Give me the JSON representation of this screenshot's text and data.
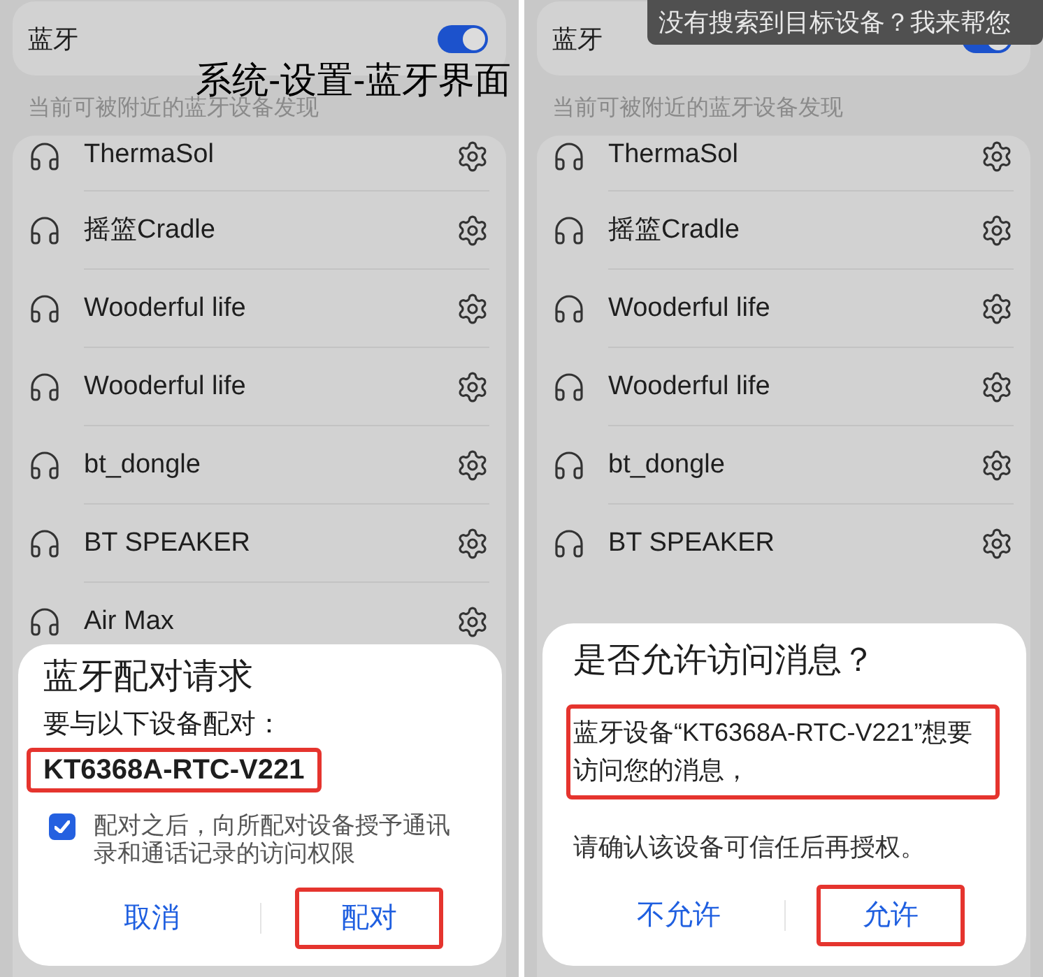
{
  "annotation": {
    "caption": "系统-设置-蓝牙界面"
  },
  "panels": [
    {
      "bluetooth": {
        "label": "蓝牙",
        "on": true
      },
      "visibility_hint": "当前可被附近的蓝牙设备发现",
      "devices": [
        {
          "name": "ThermaSol"
        },
        {
          "name": "摇篮Cradle"
        },
        {
          "name": "Wooderful life"
        },
        {
          "name": "Wooderful life"
        },
        {
          "name": "bt_dongle"
        },
        {
          "name": "BT SPEAKER"
        },
        {
          "name": "Air Max"
        }
      ],
      "dialog": {
        "kind": "pairing",
        "title": "蓝牙配对请求",
        "prompt": "要与以下设备配对：",
        "device": {
          "name": "KT6368A-RTC-V221",
          "highlighted": true
        },
        "consent": {
          "text": "配对之后，向所配对设备授予通讯录和通话记录的访问权限",
          "checked": true
        },
        "buttons": [
          {
            "label": "取消",
            "highlighted": false
          },
          {
            "label": "配对",
            "highlighted": true
          }
        ]
      }
    },
    {
      "toast": "没有搜索到目标设备？我来帮您",
      "bluetooth": {
        "label": "蓝牙",
        "on": true
      },
      "visibility_hint": "当前可被附近的蓝牙设备发现",
      "devices": [
        {
          "name": "ThermaSol"
        },
        {
          "name": "摇篮Cradle"
        },
        {
          "name": "Wooderful life"
        },
        {
          "name": "Wooderful life"
        },
        {
          "name": "bt_dongle"
        },
        {
          "name": "BT SPEAKER"
        }
      ],
      "dialog": {
        "kind": "message_access",
        "title": "是否允许访问消息？",
        "message": {
          "text": "蓝牙设备“KT6368A-RTC-V221”想要访问您的消息，",
          "highlighted": true
        },
        "note": "请确认该设备可信任后再授权。",
        "buttons": [
          {
            "label": "不允许",
            "highlighted": false
          },
          {
            "label": "允许",
            "highlighted": true
          }
        ]
      }
    }
  ]
}
